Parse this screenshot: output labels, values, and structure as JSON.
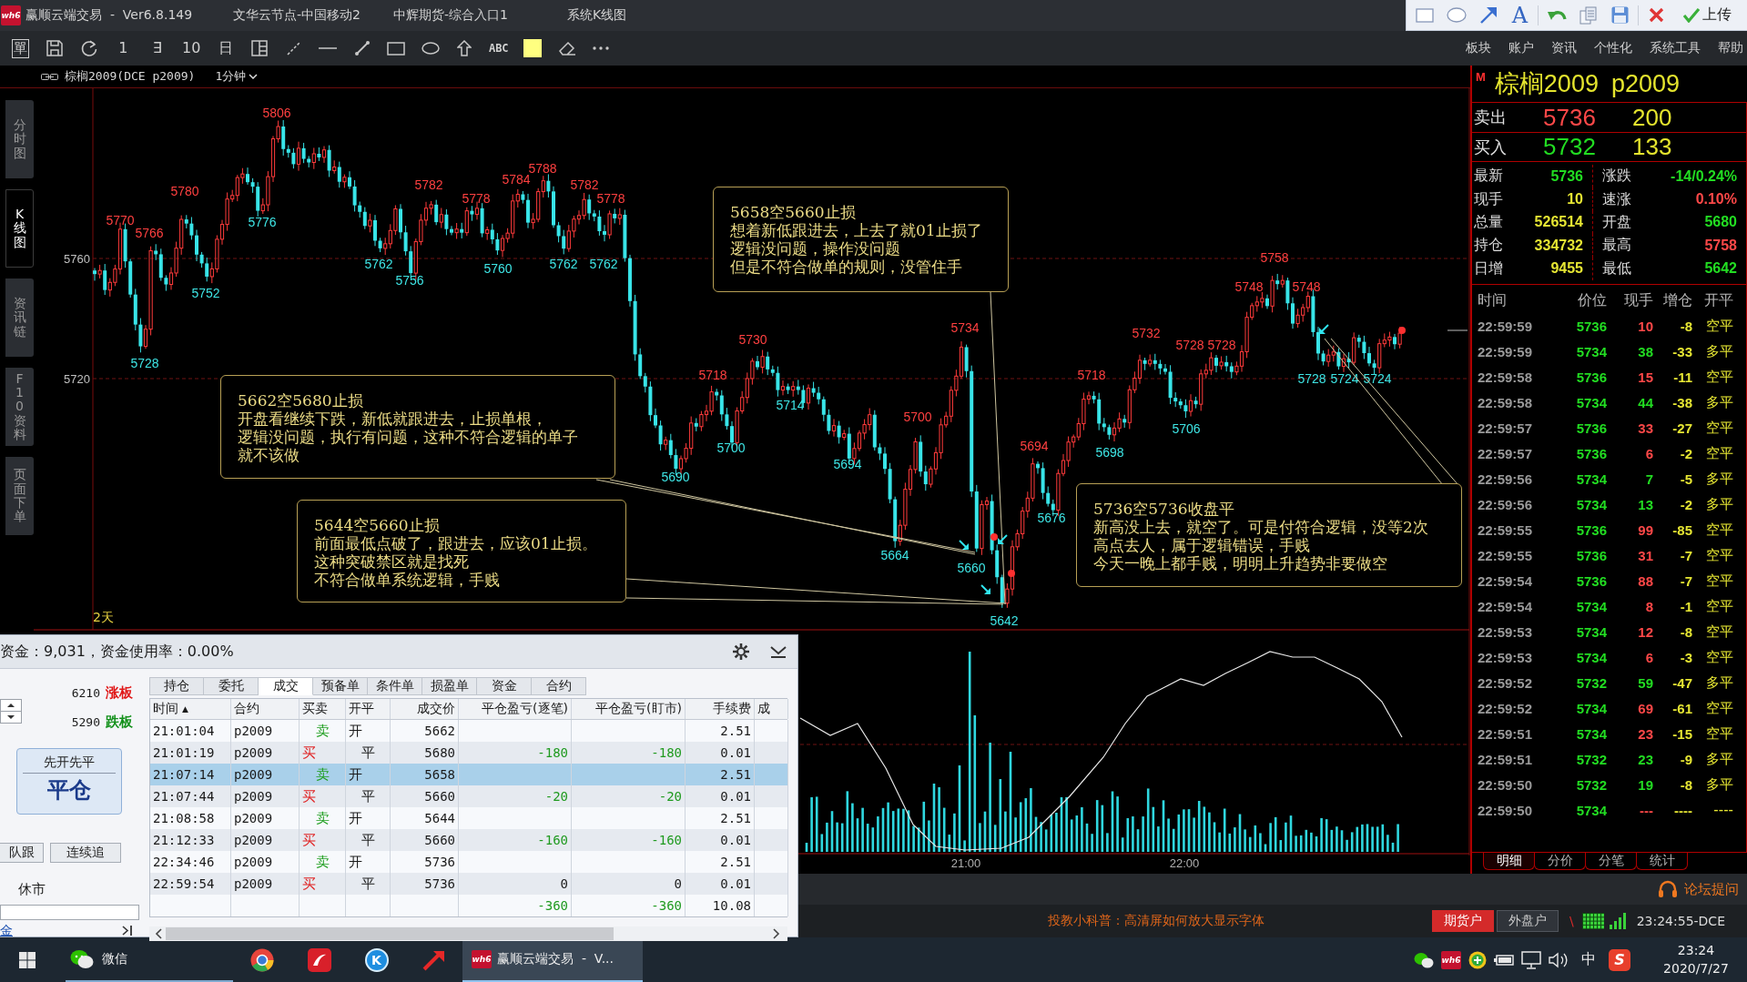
{
  "window": {
    "logo": "wh6",
    "title": "赢顺云端交易  -  Ver6.8.149",
    "node": "文华云节点-中国移动2",
    "entry": "中辉期货-综合入口1",
    "view": "系统K线图"
  },
  "markup_toolbar": {
    "text_tool": "A",
    "upload": "上传"
  },
  "toolbar": {
    "order_glyph": "單",
    "period_glyphs": [
      "1",
      "∃",
      "10",
      "日"
    ],
    "text_tool": "ABC"
  },
  "menu": [
    "板块",
    "账户",
    "资讯",
    "个性化",
    "系统工具",
    "帮助"
  ],
  "chart": {
    "symbol": "棕榈2009(DCE p2009)",
    "period": "1分钟",
    "side_tabs": [
      {
        "label": "分时图",
        "selected": false
      },
      {
        "label": "K线图",
        "selected": true
      },
      {
        "label": "资讯链",
        "selected": false
      },
      {
        "label": "F10资料",
        "selected": false
      },
      {
        "label": "页面下单",
        "selected": false
      }
    ],
    "price_ticks": [
      "5760",
      "5720"
    ],
    "range": "2天",
    "price_labels": [
      {
        "text": "5770",
        "kind": "high"
      },
      {
        "text": "5728",
        "kind": "low"
      },
      {
        "text": "5766",
        "kind": "high"
      },
      {
        "text": "5780",
        "kind": "high"
      },
      {
        "text": "5752",
        "kind": "low"
      },
      {
        "text": "5776",
        "kind": "low"
      },
      {
        "text": "5806",
        "kind": "high"
      },
      {
        "text": "5762",
        "kind": "low"
      },
      {
        "text": "5756",
        "kind": "low"
      },
      {
        "text": "5782",
        "kind": "high"
      },
      {
        "text": "5778",
        "kind": "high"
      },
      {
        "text": "5760",
        "kind": "low"
      },
      {
        "text": "5784",
        "kind": "high"
      },
      {
        "text": "5788",
        "kind": "high"
      },
      {
        "text": "5762",
        "kind": "low"
      },
      {
        "text": "5782",
        "kind": "high"
      },
      {
        "text": "5762",
        "kind": "low"
      },
      {
        "text": "5778",
        "kind": "high"
      },
      {
        "text": "5690",
        "kind": "low"
      },
      {
        "text": "5718",
        "kind": "high"
      },
      {
        "text": "5700",
        "kind": "low"
      },
      {
        "text": "5730",
        "kind": "high"
      },
      {
        "text": "5714",
        "kind": "low"
      },
      {
        "text": "5694",
        "kind": "low"
      },
      {
        "text": "5664",
        "kind": "low"
      },
      {
        "text": "5700",
        "kind": "high"
      },
      {
        "text": "5734",
        "kind": "high"
      },
      {
        "text": "5660",
        "kind": "low"
      },
      {
        "text": "5642",
        "kind": "low"
      },
      {
        "text": "5694",
        "kind": "high"
      },
      {
        "text": "5676",
        "kind": "low"
      },
      {
        "text": "5718",
        "kind": "high"
      },
      {
        "text": "5698",
        "kind": "low"
      },
      {
        "text": "5732",
        "kind": "high"
      },
      {
        "text": "5706",
        "kind": "low"
      },
      {
        "text": "5728",
        "kind": "high"
      },
      {
        "text": "5728",
        "kind": "high"
      },
      {
        "text": "5748",
        "kind": "high"
      },
      {
        "text": "5758",
        "kind": "high"
      },
      {
        "text": "5748",
        "kind": "high"
      },
      {
        "text": "5728",
        "kind": "low"
      },
      {
        "text": "5724",
        "kind": "low"
      },
      {
        "text": "5724",
        "kind": "low"
      }
    ],
    "notes": [
      {
        "lines": [
          "5658空5660止损",
          "想着新低跟进去，上去了就01止损了",
          "逻辑没问题，操作没问题",
          "但是不符合做单的规则，没管住手"
        ]
      },
      {
        "lines": [
          "5662空5680止损",
          "开盘看继续下跌，新低就跟进去，止损单根，",
          "逻辑没问题，执行有问题，这种不符合逻辑的单子",
          "就不该做"
        ]
      },
      {
        "lines": [
          "5644空5660止损",
          "前面最低点破了，跟进去，应该01止损。",
          "这种突破禁区就是找死",
          "不符合做单系统逻辑，手贱"
        ]
      },
      {
        "lines": [
          "5736空5736收盘平",
          "新高没上去，就空了。可是付符合逻辑，没等2次",
          "高点去人，属于逻辑错误，手贱",
          "今天一晚上都手贱，明明上升趋势非要做空"
        ]
      }
    ]
  },
  "volume_chart": {
    "time_ticks": [
      "21:00",
      "22:00"
    ]
  },
  "quote": {
    "marker": "M",
    "name": "棕榈2009",
    "code": "p2009",
    "book": [
      {
        "kind": "ask",
        "label": "卖出",
        "price": "5736",
        "volume": "200"
      },
      {
        "kind": "bid",
        "label": "买入",
        "price": "5732",
        "volume": "133"
      }
    ],
    "stats": [
      {
        "label": "最新",
        "value": "5736",
        "color": "#22dd22"
      },
      {
        "label": "涨跌",
        "value": "-14/0.24%",
        "color": "#22dd22"
      },
      {
        "label": "现手",
        "value": "10",
        "color": "#e6e633"
      },
      {
        "label": "速涨",
        "value": "0.10%",
        "color": "#ff4848"
      },
      {
        "label": "总量",
        "value": "526514",
        "color": "#e6e633"
      },
      {
        "label": "开盘",
        "value": "5680",
        "color": "#22dd22"
      },
      {
        "label": "持仓",
        "value": "334732",
        "color": "#e6e633"
      },
      {
        "label": "最高",
        "value": "5758",
        "color": "#ff4848"
      },
      {
        "label": "日增",
        "value": "9455",
        "color": "#e6e633"
      },
      {
        "label": "最低",
        "value": "5642",
        "color": "#22dd22"
      }
    ],
    "tick_columns": [
      "时间",
      "价位",
      "现手",
      "增仓",
      "开平"
    ],
    "ticks": [
      {
        "time": "22:59:59",
        "price": "5736",
        "volume": "10",
        "change": "-8",
        "type": "空平",
        "color": "#ff4848"
      },
      {
        "time": "22:59:59",
        "price": "5734",
        "volume": "38",
        "change": "-33",
        "type": "多平",
        "color": "#22dd22"
      },
      {
        "time": "22:59:58",
        "price": "5736",
        "volume": "15",
        "change": "-11",
        "type": "空平",
        "color": "#ff4848"
      },
      {
        "time": "22:59:58",
        "price": "5734",
        "volume": "44",
        "change": "-38",
        "type": "多平",
        "color": "#22dd22"
      },
      {
        "time": "22:59:57",
        "price": "5736",
        "volume": "33",
        "change": "-27",
        "type": "空平",
        "color": "#ff4848"
      },
      {
        "time": "22:59:57",
        "price": "5736",
        "volume": "6",
        "change": "-2",
        "type": "空平",
        "color": "#ff4848"
      },
      {
        "time": "22:59:56",
        "price": "5734",
        "volume": "7",
        "change": "-5",
        "type": "多平",
        "color": "#22dd22"
      },
      {
        "time": "22:59:56",
        "price": "5734",
        "volume": "13",
        "change": "-2",
        "type": "多平",
        "color": "#22dd22"
      },
      {
        "time": "22:59:55",
        "price": "5736",
        "volume": "99",
        "change": "-85",
        "type": "空平",
        "color": "#ff4848"
      },
      {
        "time": "22:59:55",
        "price": "5736",
        "volume": "31",
        "change": "-7",
        "type": "空平",
        "color": "#ff4848"
      },
      {
        "time": "22:59:54",
        "price": "5736",
        "volume": "88",
        "change": "-7",
        "type": "空平",
        "color": "#ff4848"
      },
      {
        "time": "22:59:54",
        "price": "5734",
        "volume": "8",
        "change": "-1",
        "type": "空平",
        "color": "#ff4848"
      },
      {
        "time": "22:59:53",
        "price": "5734",
        "volume": "12",
        "change": "-8",
        "type": "空平",
        "color": "#ff4848"
      },
      {
        "time": "22:59:53",
        "price": "5734",
        "volume": "6",
        "change": "-3",
        "type": "空平",
        "color": "#ff4848"
      },
      {
        "time": "22:59:52",
        "price": "5732",
        "volume": "59",
        "change": "-47",
        "type": "多平",
        "color": "#22dd22"
      },
      {
        "time": "22:59:52",
        "price": "5734",
        "volume": "69",
        "change": "-61",
        "type": "空平",
        "color": "#ff4848"
      },
      {
        "time": "22:59:51",
        "price": "5734",
        "volume": "23",
        "change": "-15",
        "type": "空平",
        "color": "#ff4848"
      },
      {
        "time": "22:59:51",
        "price": "5732",
        "volume": "23",
        "change": "-9",
        "type": "多平",
        "color": "#22dd22"
      },
      {
        "time": "22:59:50",
        "price": "5732",
        "volume": "19",
        "change": "-8",
        "type": "多平",
        "color": "#22dd22"
      },
      {
        "time": "22:59:50",
        "price": "5734",
        "volume": "---",
        "change": "----",
        "type": "----",
        "color": "#ff4848"
      }
    ],
    "tabs": [
      {
        "label": "明细",
        "selected": true
      },
      {
        "label": "分价",
        "selected": false
      },
      {
        "label": "分笔",
        "selected": false
      },
      {
        "label": "统计",
        "selected": false
      }
    ]
  },
  "trade_panel": {
    "funds": "资金：9,031，资金使用率：0.00%",
    "limits": [
      {
        "price": "6210",
        "label": "涨板",
        "kind": "up"
      },
      {
        "price": "5290",
        "label": "跌板",
        "kind": "down"
      }
    ],
    "mode": {
      "caption": "先开先平",
      "label": "平仓"
    },
    "buttons": [
      "队跟",
      "连续追"
    ],
    "market_state": "休市",
    "deposit_link": "金",
    "tabs": [
      {
        "label": "持仓",
        "selected": false
      },
      {
        "label": "委托",
        "selected": false
      },
      {
        "label": "成交",
        "selected": true
      },
      {
        "label": "预备单",
        "selected": false
      },
      {
        "label": "条件单",
        "selected": false
      },
      {
        "label": "损盈单",
        "selected": false
      },
      {
        "label": "资金",
        "selected": false
      },
      {
        "label": "合约",
        "selected": false
      }
    ],
    "columns": [
      {
        "label": "时间",
        "sort_mark": "▲"
      },
      {
        "label": "合约"
      },
      {
        "label": "买卖"
      },
      {
        "label": "开平"
      },
      {
        "label": "成交价"
      },
      {
        "label": "平仓盈亏(逐笔)"
      },
      {
        "label": "平仓盈亏(盯市)"
      },
      {
        "label": "手续费"
      },
      {
        "label": "成"
      }
    ],
    "rows": [
      {
        "time": "21:01:04",
        "contract": "p2009",
        "side": "卖",
        "kind": "sell",
        "offset": "开",
        "price": "5662",
        "fee": "2.51",
        "selected": false
      },
      {
        "time": "21:01:19",
        "contract": "p2009",
        "side": "买",
        "kind": "buy",
        "offset": "平",
        "price": "5680",
        "pnl_each": {
          "text": "-180",
          "color": "#1f9a1f"
        },
        "pnl_mark": {
          "text": "-180",
          "color": "#1f9a1f"
        },
        "fee": "0.01",
        "selected": false
      },
      {
        "time": "21:07:14",
        "contract": "p2009",
        "side": "卖",
        "kind": "sell",
        "offset": "开",
        "price": "5658",
        "fee": "2.51",
        "selected": true
      },
      {
        "time": "21:07:44",
        "contract": "p2009",
        "side": "买",
        "kind": "buy",
        "offset": "平",
        "price": "5660",
        "pnl_each": {
          "text": "-20",
          "color": "#1f9a1f"
        },
        "pnl_mark": {
          "text": "-20",
          "color": "#1f9a1f"
        },
        "fee": "0.01",
        "selected": false
      },
      {
        "time": "21:08:58",
        "contract": "p2009",
        "side": "卖",
        "kind": "sell",
        "offset": "开",
        "price": "5644",
        "fee": "2.51",
        "selected": false
      },
      {
        "time": "21:12:33",
        "contract": "p2009",
        "side": "买",
        "kind": "buy",
        "offset": "平",
        "price": "5660",
        "pnl_each": {
          "text": "-160",
          "color": "#1f9a1f"
        },
        "pnl_mark": {
          "text": "-160",
          "color": "#1f9a1f"
        },
        "fee": "0.01",
        "selected": false
      },
      {
        "time": "22:34:46",
        "contract": "p2009",
        "side": "卖",
        "kind": "sell",
        "offset": "开",
        "price": "5736",
        "fee": "2.51",
        "selected": false
      },
      {
        "time": "22:59:54",
        "contract": "p2009",
        "side": "买",
        "kind": "buy",
        "offset": "平",
        "price": "5736",
        "pnl_each": {
          "text": "0",
          "color": "#1a1a1a"
        },
        "pnl_mark": {
          "text": "0",
          "color": "#1a1a1a"
        },
        "fee": "0.01",
        "selected": false
      }
    ],
    "totals": {
      "pnl_each": {
        "text": "-360",
        "color": "#1f9a1f"
      },
      "pnl_mark": {
        "text": "-360",
        "color": "#1f9a1f"
      },
      "fee": "10.08"
    }
  },
  "forum_link": "论坛提问",
  "status_bar": {
    "tip": "投教小科普：高清屏如何放大显示字体",
    "account_tabs": [
      {
        "label": "期货户",
        "selected": true
      },
      {
        "label": "外盘户",
        "selected": false
      }
    ],
    "separator": "\\",
    "clock": "23:24:55-DCE"
  },
  "taskbar": {
    "chat": {
      "label": "微信",
      "running": true
    },
    "letter_logo": "K",
    "window": {
      "logo": "wh6",
      "title": "赢顺云端交易  -  V...",
      "selected": true
    },
    "tray": {
      "logo": "wh6",
      "ime": "中",
      "input_logo": "S",
      "time": "23:24",
      "date": "2020/7/27"
    }
  }
}
